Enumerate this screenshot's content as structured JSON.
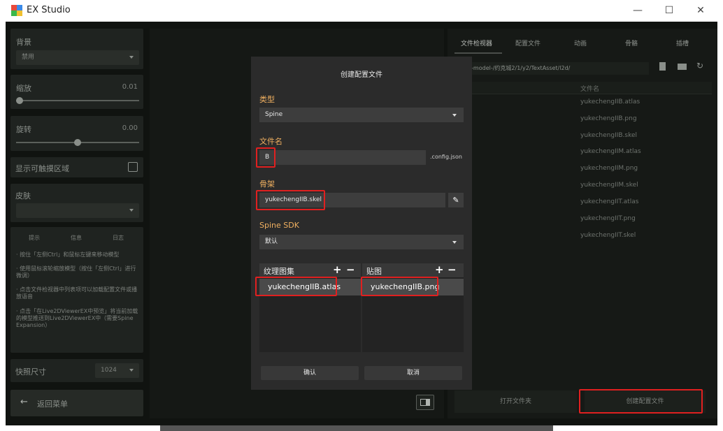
{
  "window": {
    "title": "EX Studio",
    "minimize_glyph": "—",
    "maximize_glyph": "☐",
    "close_glyph": "✕"
  },
  "left_panel": {
    "background_label": "背景",
    "background_value": "禁用",
    "scale_label": "缩放",
    "scale_value": "0.01",
    "rotate_label": "旋转",
    "rotate_value": "0.00",
    "rotate_level": 0.5,
    "touch_label": "显示可触摸区域",
    "skin_label": "皮肤",
    "skin_value": "",
    "info_tabs": [
      "提示",
      "信息",
      "日志"
    ],
    "tips": [
      "· 按住「左侧Ctrl」和鼠标左键来移动模型",
      "· 使用鼠标滚轮缩放模型（按住「左侧Ctrl」进行微调）",
      "· 点击文件检视器中列表项可以加载配置文件或播放语音",
      "· 点击「在Live2DViewerEX中预览」将当前加载的模型推送到Live2DViewerEX中（需要Spine Expansion）"
    ],
    "snapshot_label": "快照尺寸",
    "snapshot_value": "1024",
    "back_label": "返回菜单"
  },
  "right_panel": {
    "tabs": [
      "文件检视器",
      "配置文件",
      "动画",
      "骨骼",
      "插槽"
    ],
    "path": "ive2d-model-/约克城2/1/y2/TextAsset/l2d/",
    "column_header": "文件名",
    "files": [
      "yukechengIIB.atlas",
      "yukechengIIB.png",
      "yukechengIIB.skel",
      "yukechengIIM.atlas",
      "yukechengIIM.png",
      "yukechengIIM.skel",
      "yukechengIIT.atlas",
      "yukechengIIT.png",
      "yukechengIIT.skel"
    ],
    "open_folder_label": "打开文件夹",
    "create_config_label": "创建配置文件"
  },
  "dialog": {
    "title": "创建配置文件",
    "type_label": "类型",
    "type_value": "Spine",
    "filename_label": "文件名",
    "filename_value": "B",
    "filename_suffix": ".config.json",
    "skeleton_label": "骨架",
    "skeleton_value": "yukechengIIB.skel",
    "sdk_label": "Spine SDK",
    "sdk_value": "默认",
    "atlas_header": "纹理图集",
    "texture_header": "贴图",
    "plus": "+",
    "minus": "−",
    "atlas_item": "yukechengIIB.atlas",
    "texture_item": "yukechengIIB.png",
    "confirm_label": "确认",
    "cancel_label": "取消"
  },
  "colors": {
    "accent": "#f0b060",
    "highlight": "#e02020"
  }
}
